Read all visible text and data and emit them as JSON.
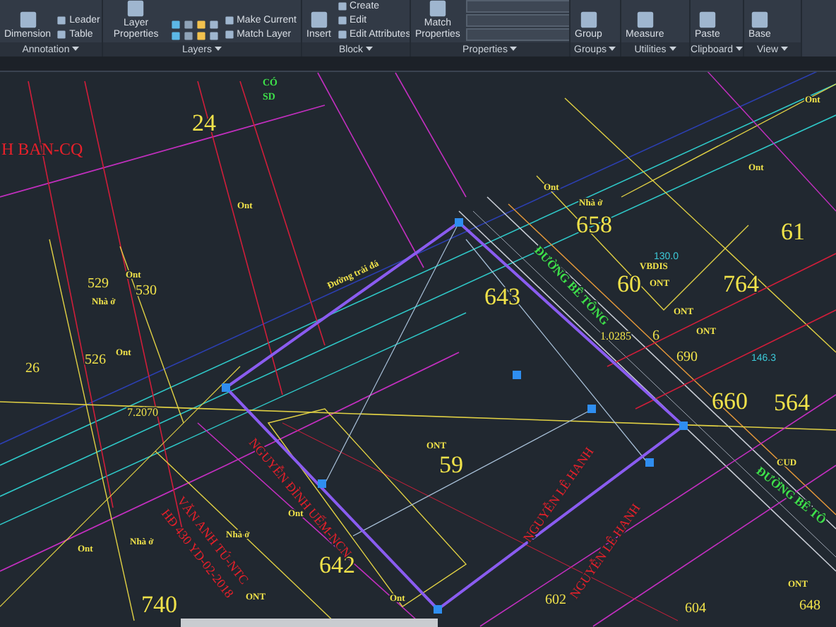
{
  "ribbon": {
    "panels": [
      {
        "title": "Annotation",
        "tools": [
          {
            "kind": "large",
            "label": "Dimension"
          },
          {
            "kind": "small",
            "label": "Leader"
          },
          {
            "kind": "small",
            "label": "Table"
          }
        ]
      },
      {
        "title": "Layers",
        "tools": [
          {
            "kind": "large",
            "label": "Layer Properties"
          },
          {
            "kind": "iconrow"
          },
          {
            "kind": "small",
            "label": "Make Current"
          },
          {
            "kind": "small",
            "label": "Match Layer"
          }
        ]
      },
      {
        "title": "Block",
        "tools": [
          {
            "kind": "large",
            "label": "Insert"
          },
          {
            "kind": "small",
            "label": "Create"
          },
          {
            "kind": "small",
            "label": "Edit"
          },
          {
            "kind": "small",
            "label": "Edit Attributes"
          }
        ]
      },
      {
        "title": "Properties",
        "tools": [
          {
            "kind": "large",
            "label": "Match Properties"
          },
          {
            "kind": "dropdowns"
          }
        ]
      },
      {
        "title": "Groups",
        "tools": [
          {
            "kind": "large",
            "label": "Group"
          }
        ]
      },
      {
        "title": "Utilities",
        "tools": [
          {
            "kind": "large",
            "label": "Measure"
          }
        ]
      },
      {
        "title": "Clipboard",
        "tools": [
          {
            "kind": "large",
            "label": "Paste"
          }
        ]
      },
      {
        "title": "View",
        "tools": [
          {
            "kind": "large",
            "label": "Base"
          }
        ]
      }
    ]
  },
  "drawing": {
    "labels": [
      {
        "text": "H BAN-CQ",
        "kind": "owner-large"
      },
      {
        "text": "24",
        "kind": "lot"
      },
      {
        "text": "CÓ",
        "kind": "note-green"
      },
      {
        "text": "SD",
        "kind": "note-green"
      },
      {
        "text": "Ont",
        "kind": "use"
      },
      {
        "text": "529",
        "kind": "lot-small"
      },
      {
        "text": "530",
        "kind": "lot-small"
      },
      {
        "text": "Ont",
        "kind": "use"
      },
      {
        "text": "Nhà ở",
        "kind": "use"
      },
      {
        "text": "526",
        "kind": "lot-small"
      },
      {
        "text": "26",
        "kind": "lot-small"
      },
      {
        "text": "Ont",
        "kind": "use"
      },
      {
        "text": "7.2070",
        "kind": "dimension"
      },
      {
        "text": "Đường trải đá",
        "kind": "note"
      },
      {
        "text": "Ont",
        "kind": "use"
      },
      {
        "text": "Nhà ở",
        "kind": "use"
      },
      {
        "text": "658",
        "kind": "lot"
      },
      {
        "text": "ĐƯỜNG BÊ TÔNG",
        "kind": "road"
      },
      {
        "text": "643",
        "kind": "lot"
      },
      {
        "text": "130.0",
        "kind": "area"
      },
      {
        "text": "VBDIS",
        "kind": "use"
      },
      {
        "text": "60",
        "kind": "lot"
      },
      {
        "text": "ONT",
        "kind": "use"
      },
      {
        "text": "764",
        "kind": "lot"
      },
      {
        "text": "61",
        "kind": "lot"
      },
      {
        "text": "Ont",
        "kind": "use"
      },
      {
        "text": "Ont",
        "kind": "use"
      },
      {
        "text": "1.0285",
        "kind": "dimension"
      },
      {
        "text": "6",
        "kind": "lot-small"
      },
      {
        "text": "ONT",
        "kind": "use"
      },
      {
        "text": "690",
        "kind": "lot-small"
      },
      {
        "text": "ONT",
        "kind": "use"
      },
      {
        "text": "146.3",
        "kind": "area"
      },
      {
        "text": "660",
        "kind": "lot"
      },
      {
        "text": "564",
        "kind": "lot"
      },
      {
        "text": "CUD",
        "kind": "use"
      },
      {
        "text": "ĐƯỜNG BÊ TÔ",
        "kind": "road"
      },
      {
        "text": "ONT",
        "kind": "use"
      },
      {
        "text": "59",
        "kind": "lot"
      },
      {
        "text": "NGUYỄN LÊ HANH",
        "kind": "owner"
      },
      {
        "text": "NGUYỄN LÊ HANH",
        "kind": "owner"
      },
      {
        "text": "602",
        "kind": "lot-small"
      },
      {
        "text": "604",
        "kind": "lot-small"
      },
      {
        "text": "ONT",
        "kind": "use"
      },
      {
        "text": "648",
        "kind": "lot-small"
      },
      {
        "text": "642",
        "kind": "lot"
      },
      {
        "text": "Ont",
        "kind": "use"
      },
      {
        "text": "Ont",
        "kind": "use"
      },
      {
        "text": "NGUYỄN ĐÌNH UẾM-NCN",
        "kind": "owner"
      },
      {
        "text": "VĂN ANH TÚ-NTC",
        "kind": "owner"
      },
      {
        "text": "HĐ 430 YD-02-2018",
        "kind": "owner"
      },
      {
        "text": "Nhà ở",
        "kind": "use"
      },
      {
        "text": "Nhà ở",
        "kind": "use"
      },
      {
        "text": "ONT",
        "kind": "use"
      },
      {
        "text": "Ont",
        "kind": "use"
      },
      {
        "text": "740",
        "kind": "lot"
      }
    ]
  }
}
